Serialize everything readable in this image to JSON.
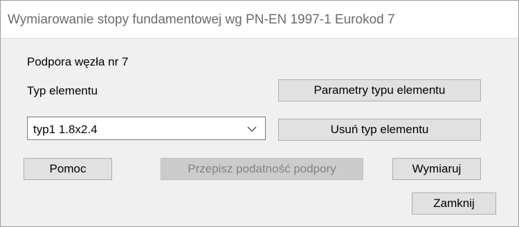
{
  "window": {
    "title": "Wymiarowanie stopy fundamentowej wg PN-EN 1997-1 Eurokod 7"
  },
  "dialog": {
    "support_label": "Podpora węzła nr 7",
    "element_type_label": "Typ elementu",
    "element_type_select": {
      "selected": "typ1 1.8x2.4"
    },
    "buttons": {
      "parameters": "Parametry typu elementu",
      "remove_type": "Usuń typ elementu",
      "help": "Pomoc",
      "rewrite_compliance": "Przepisz podatność podpory",
      "design": "Wymiaruj",
      "close": "Zamknij"
    }
  },
  "colors": {
    "button_face": "#e1e1e1",
    "disabled_face": "#cccccc",
    "disabled_text": "#838383",
    "title_text": "#6b6b6b"
  },
  "icons": {
    "select_arrow": "chevron-down-icon"
  }
}
